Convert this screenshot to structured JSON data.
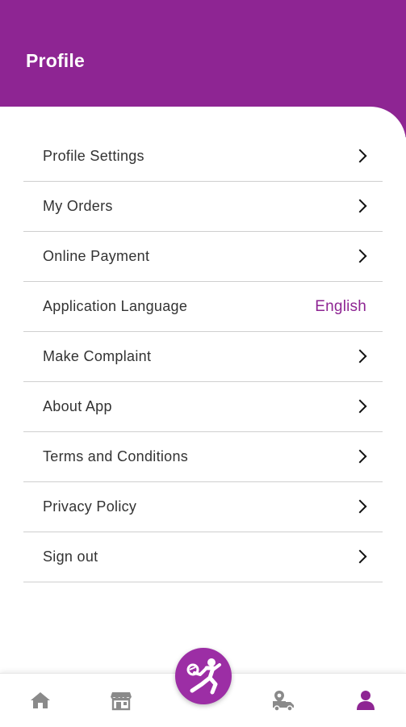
{
  "header": {
    "title": "Profile"
  },
  "menu": {
    "items": [
      {
        "label": "Profile Settings"
      },
      {
        "label": "My Orders"
      },
      {
        "label": "Online Payment"
      },
      {
        "label": "Application Language",
        "value": "English"
      },
      {
        "label": "Make Complaint"
      },
      {
        "label": "About App"
      },
      {
        "label": "Terms and Conditions"
      },
      {
        "label": "Privacy Policy"
      },
      {
        "label": "Sign out"
      }
    ]
  },
  "bottom_nav": {
    "items": [
      {
        "icon": "home-icon",
        "active": false
      },
      {
        "icon": "store-icon",
        "active": false
      },
      {
        "icon": "delivery-icon",
        "active": false
      },
      {
        "icon": "user-icon",
        "active": true
      }
    ],
    "center_icon": "runner-logo-icon"
  },
  "colors": {
    "brand": "#8e2593",
    "fab": "#9c2ea5",
    "icon_inactive": "#8a8a8a",
    "text": "#333333"
  }
}
